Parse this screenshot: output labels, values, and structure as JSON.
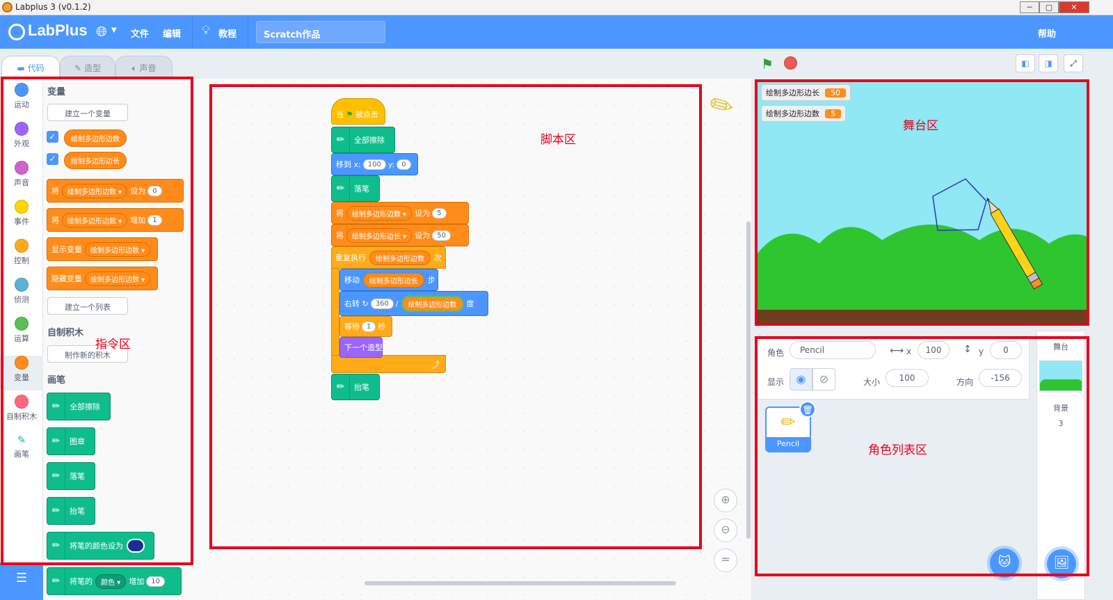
{
  "window": {
    "title": "Labplus 3 (v0.1.2)"
  },
  "menubar": {
    "logo": "LabPlus",
    "file": "文件",
    "edit": "编辑",
    "tutorial": "教程",
    "project_title": "Scratch作品",
    "help": "帮助",
    "accent": "#4c97ff"
  },
  "tabs": {
    "code": "代码",
    "costumes": "造型",
    "sounds": "声音"
  },
  "categories": [
    {
      "label": "运动",
      "color": "#4c97ff"
    },
    {
      "label": "外观",
      "color": "#9966ff"
    },
    {
      "label": "声音",
      "color": "#cf63cf"
    },
    {
      "label": "事件",
      "color": "#ffd500"
    },
    {
      "label": "控制",
      "color": "#ffab19"
    },
    {
      "label": "侦测",
      "color": "#5cb1d6"
    },
    {
      "label": "运算",
      "color": "#59c059"
    },
    {
      "label": "变量",
      "color": "#ff8c1a"
    },
    {
      "label": "自制积木",
      "color": "#ff6680"
    },
    {
      "label": "画笔",
      "color": "#0fbd8c"
    }
  ],
  "palette": {
    "variables_heading": "变量",
    "make_variable": "建立一个变量",
    "var_sides": "绘制多边形边数",
    "var_length": "绘制多边形边长",
    "set_word": "将",
    "set_to": "设为",
    "set_value": "0",
    "change_by": "增加",
    "change_value": "1",
    "show_variable": "显示变量",
    "hide_variable": "隐藏变量",
    "make_list": "建立一个列表",
    "my_blocks_heading": "自制积木",
    "make_block": "制作新的积木",
    "pen_heading": "画笔",
    "pen_clear": "全部擦除",
    "pen_stamp": "图章",
    "pen_down": "落笔",
    "pen_up": "抬笔",
    "pen_set_color": "将笔的颜色设为",
    "pen_color_swatch": "#1b2f8f",
    "pen_change_prefix": "将笔的",
    "pen_change_param": "颜色",
    "pen_change_word": "增加",
    "pen_change_value": "10"
  },
  "script": {
    "when": "当",
    "clicked": "被点击",
    "clear": "全部擦除",
    "goto": "移到 x:",
    "goto_x": "100",
    "goto_y_label": "y:",
    "goto_y": "0",
    "pen_down": "落笔",
    "set_word": "将",
    "set_to": "设为",
    "var_sides": "绘制多边形边数",
    "var_length": "绘制多边形边长",
    "sides_value": "5",
    "length_value": "50",
    "repeat": "重复执行",
    "times": "次",
    "move": "移动",
    "steps": "步",
    "turn": "右转",
    "turn_num": "360",
    "divide": "/",
    "degrees": "度",
    "wait": "等待",
    "wait_value": "1",
    "seconds": "秒",
    "next_costume": "下一个造型",
    "pen_up": "抬笔"
  },
  "stage": {
    "monitors": [
      {
        "label": "绘制多边形边长",
        "value": "50"
      },
      {
        "label": "绘制多边形边数",
        "value": "5"
      }
    ]
  },
  "sprite_info": {
    "sprite_label": "角色",
    "sprite_name": "Pencil",
    "x_label": "x",
    "x_value": "100",
    "y_label": "y",
    "y_value": "0",
    "show_label": "显示",
    "size_label": "大小",
    "size_value": "100",
    "direction_label": "方向",
    "direction_value": "-156"
  },
  "sprite_list": {
    "items": [
      {
        "name": "Pencil"
      }
    ]
  },
  "stage_pane": {
    "title": "舞台",
    "backdrops_label": "背景",
    "backdrop_count": "3"
  },
  "annotations": {
    "palette": "指令区",
    "script": "脚本区",
    "stage": "舞台区",
    "sprites": "角色列表区",
    "color": "#e8001c"
  }
}
